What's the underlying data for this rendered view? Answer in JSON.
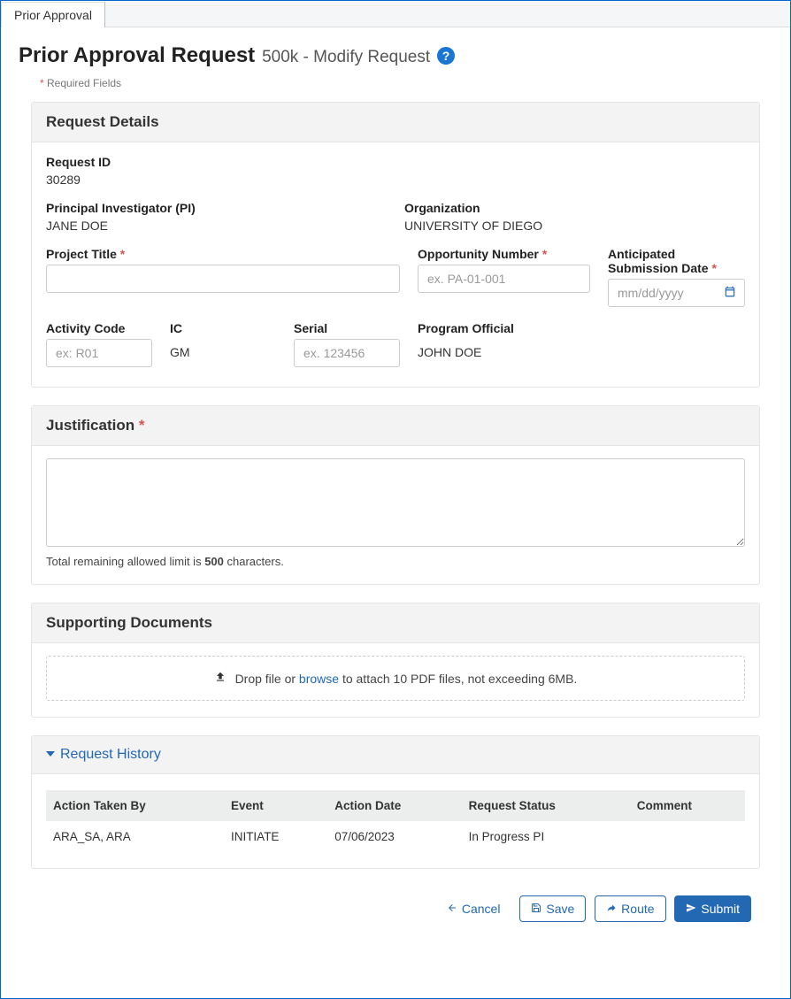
{
  "tab": {
    "label": "Prior Approval"
  },
  "header": {
    "title": "Prior Approval Request",
    "subtitle": "500k - Modify Request",
    "required_note": "Required Fields"
  },
  "details": {
    "panel_title": "Request Details",
    "request_id_label": "Request ID",
    "request_id_value": "30289",
    "pi_label": "Principal Investigator (PI)",
    "pi_value": "JANE DOE",
    "org_label": "Organization",
    "org_value": "UNIVERSITY OF DIEGO",
    "project_title_label": "Project Title",
    "project_title_value": "",
    "opp_num_label": "Opportunity Number",
    "opp_num_placeholder": "ex. PA-01-001",
    "opp_num_value": "",
    "asd_label": "Anticipated Submission Date",
    "asd_placeholder": "mm/dd/yyyy",
    "asd_value": "",
    "activity_code_label": "Activity Code",
    "activity_code_placeholder": "ex: R01",
    "activity_code_value": "",
    "ic_label": "IC",
    "ic_value": "GM",
    "serial_label": "Serial",
    "serial_placeholder": "ex. 123456",
    "serial_value": "",
    "program_official_label": "Program Official",
    "program_official_value": "JOHN DOE"
  },
  "justification": {
    "panel_title": "Justification",
    "value": "",
    "char_note_prefix": "Total remaining allowed limit is ",
    "char_limit": "500",
    "char_note_suffix": " characters."
  },
  "documents": {
    "panel_title": "Supporting Documents",
    "drop_prefix": "Drop file or ",
    "browse": "browse",
    "drop_suffix": " to attach 10 PDF files, not exceeding 6MB."
  },
  "history": {
    "panel_title": "Request History",
    "columns": [
      "Action Taken By",
      "Event",
      "Action Date",
      "Request Status",
      "Comment"
    ],
    "rows": [
      {
        "by": "ARA_SA, ARA",
        "event": "INITIATE",
        "date": "07/06/2023",
        "status": "In Progress PI",
        "comment": ""
      }
    ]
  },
  "footer": {
    "cancel": "Cancel",
    "save": "Save",
    "route": "Route",
    "submit": "Submit"
  }
}
